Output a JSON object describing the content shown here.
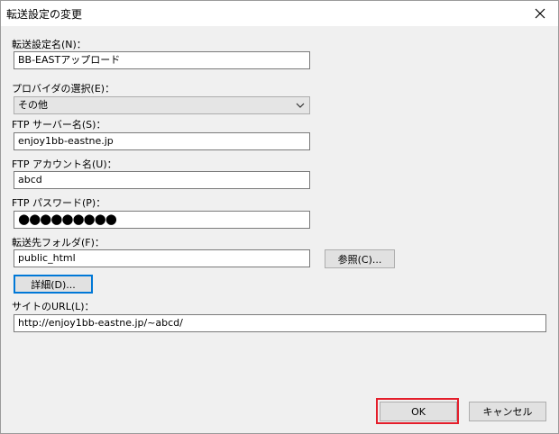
{
  "window": {
    "title": "転送設定の変更"
  },
  "fields": {
    "name": {
      "label": "転送設定名(N)：",
      "value": "BB-EASTアップロード"
    },
    "provider": {
      "label": "プロバイダの選択(E)：",
      "value": "その他"
    },
    "server": {
      "label": "FTP サーバー名(S)：",
      "value": "enjoy1bb-eastne.jp"
    },
    "account": {
      "label": "FTP アカウント名(U)：",
      "value": "abcd"
    },
    "password": {
      "label": "FTP パスワード(P)：",
      "value": "●●●●●●●●●"
    },
    "folder": {
      "label": "転送先フォルダ(F)：",
      "value": "public_html"
    },
    "url": {
      "label": "サイトのURL(L)：",
      "value": "http://enjoy1bb-eastne.jp/~abcd/"
    }
  },
  "buttons": {
    "browse": "参照(C)...",
    "details": "詳細(D)...",
    "ok": "OK",
    "cancel": "キャンセル"
  },
  "icons": {
    "close": "close-icon",
    "dropdown": "chevron-down-icon"
  },
  "colors": {
    "highlight": "#e41e2b",
    "focus": "#0078d7"
  }
}
